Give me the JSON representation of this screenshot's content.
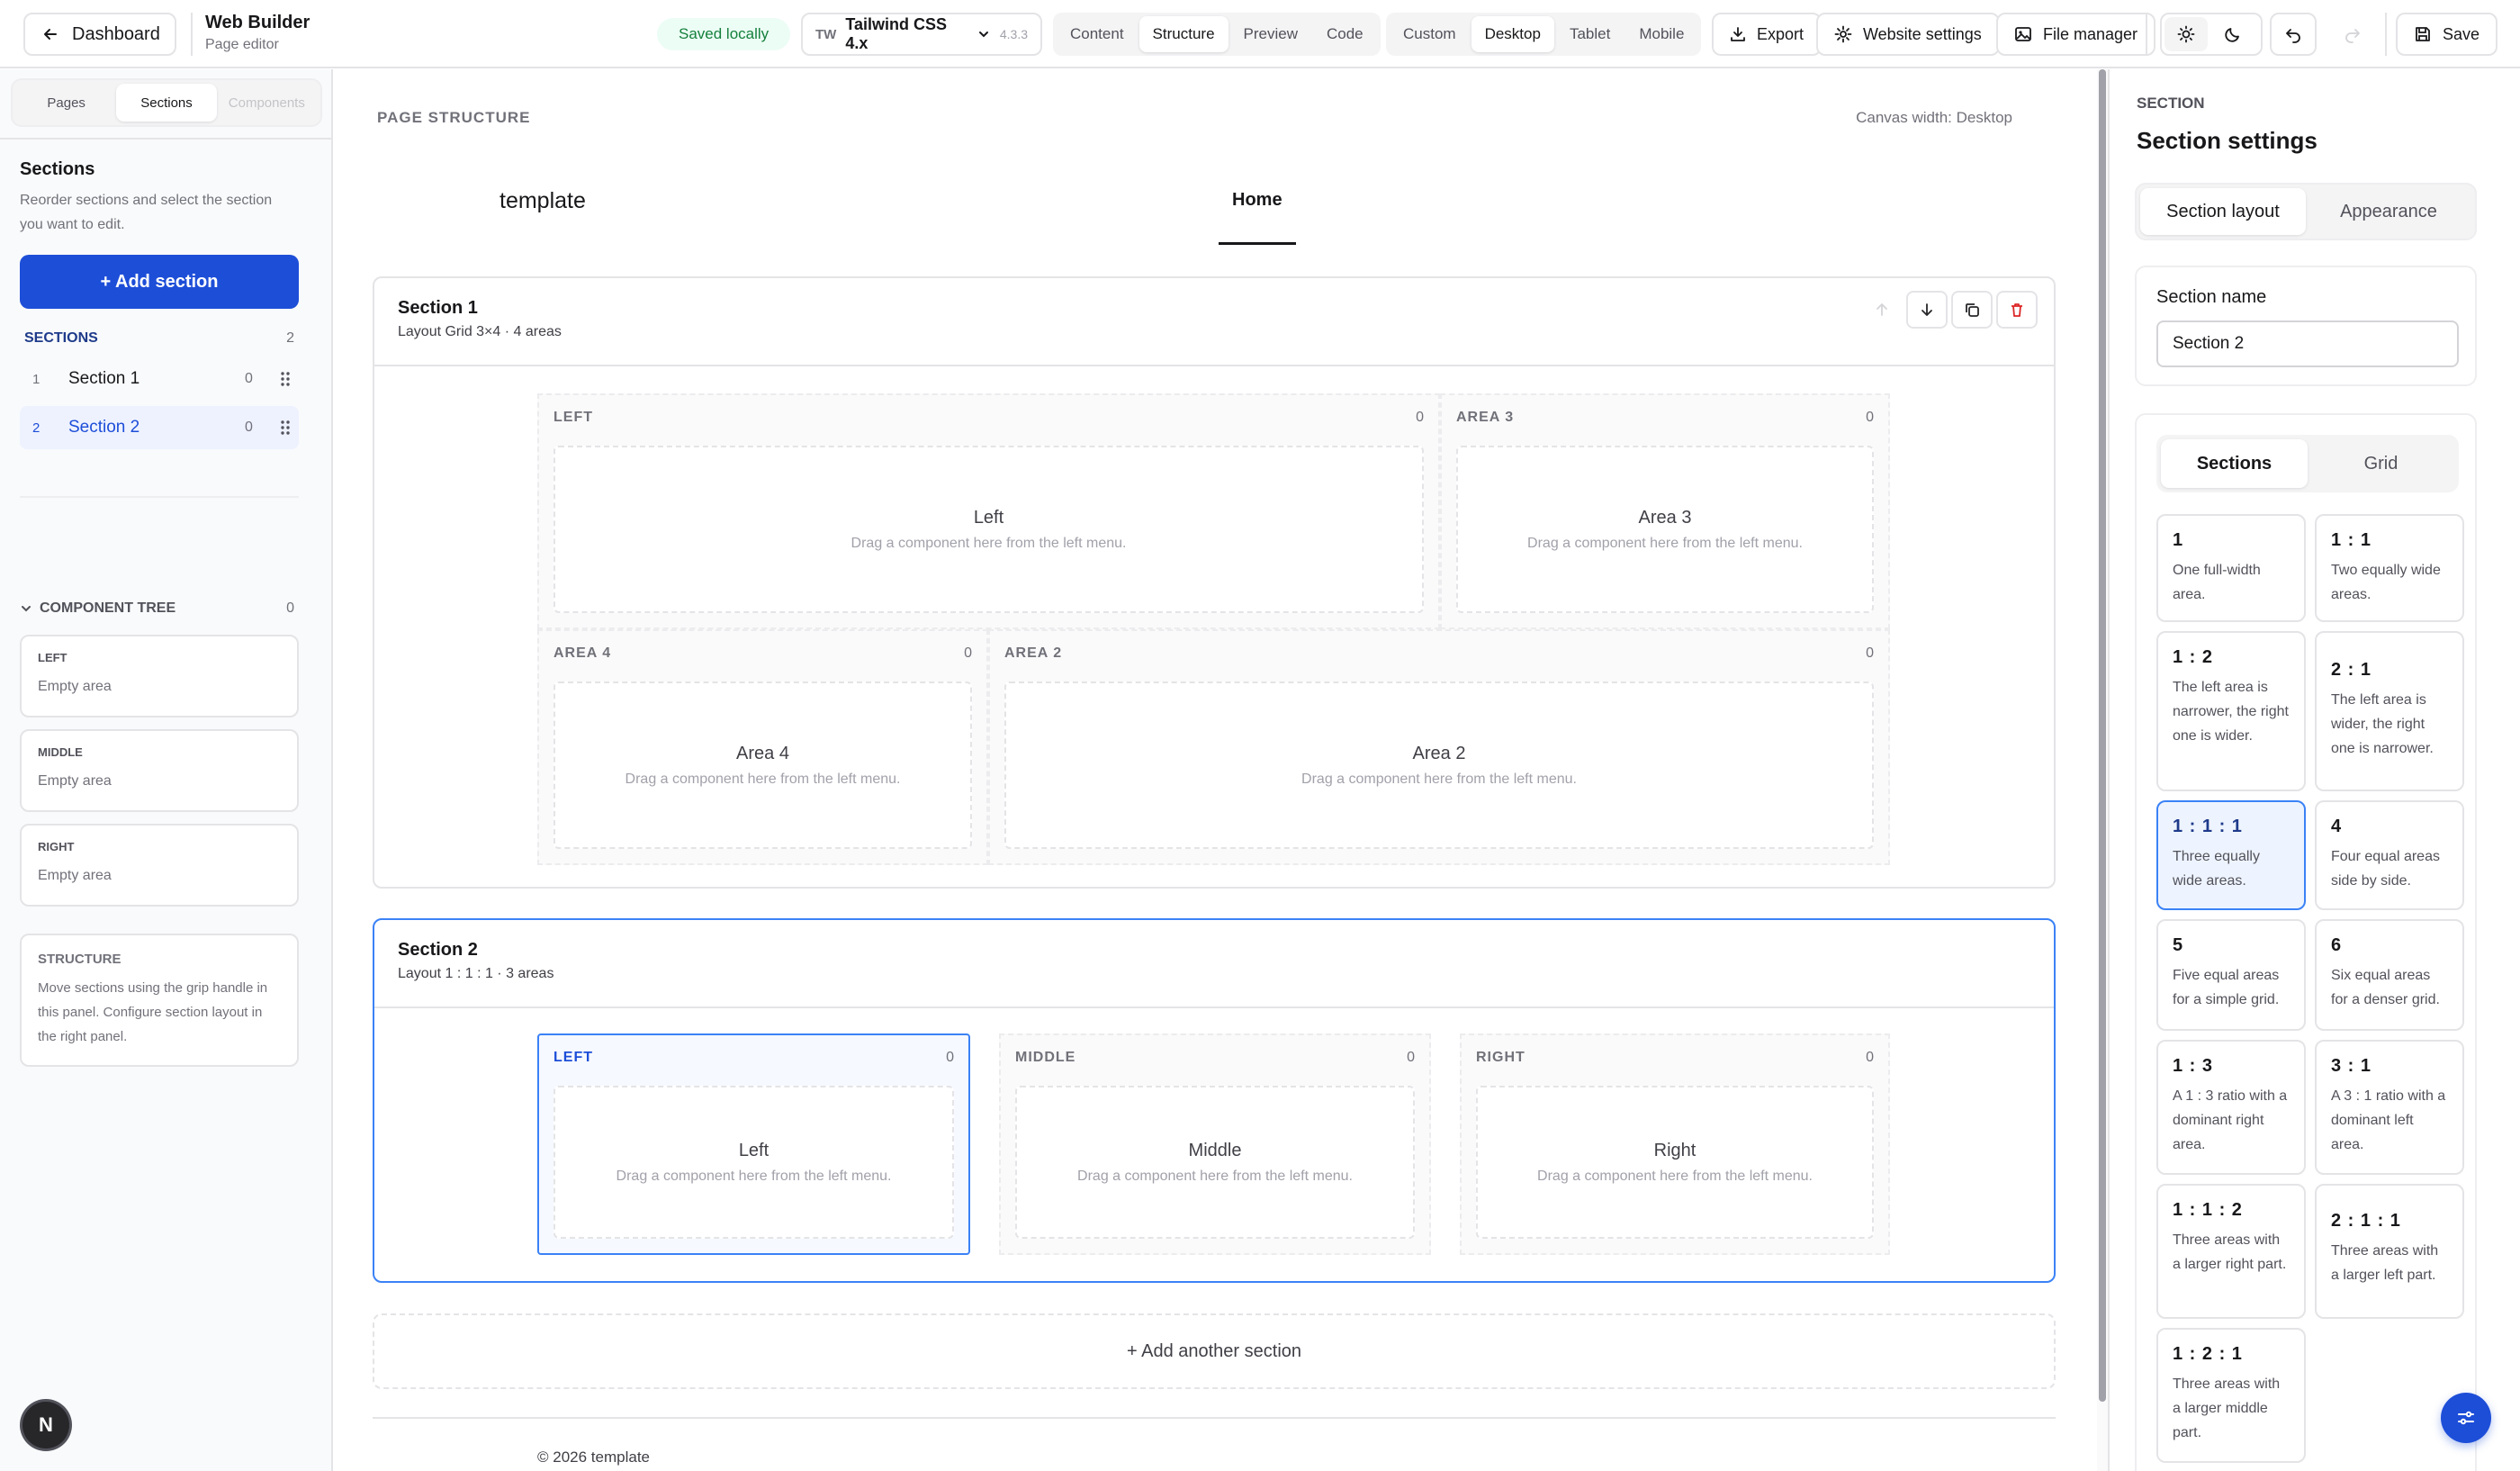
{
  "topbar": {
    "back_label": "Dashboard",
    "app_title": "Web Builder",
    "app_subtitle": "Page editor",
    "saved_status": "Saved locally",
    "framework": {
      "prefix": "TW",
      "name": "Tailwind CSS 4.x",
      "version": "4.3.3"
    },
    "view_modes": [
      "Content",
      "Structure",
      "Preview",
      "Code"
    ],
    "active_view_mode": "Structure",
    "devices": [
      "Custom",
      "Desktop",
      "Tablet",
      "Mobile"
    ],
    "active_device": "Desktop",
    "export_label": "Export",
    "website_settings_label": "Website settings",
    "file_manager_label": "File manager",
    "save_label": "Save"
  },
  "left": {
    "tabs": [
      "Pages",
      "Sections",
      "Components"
    ],
    "active_tab": "Sections",
    "title": "Sections",
    "description": "Reorder sections and select the section you want to edit.",
    "add_button": "+ Add section",
    "sections_header": "SECTIONS",
    "sections_count": "2",
    "sections": [
      {
        "num": "1",
        "label": "Section 1",
        "count": "0"
      },
      {
        "num": "2",
        "label": "Section 2",
        "count": "0"
      }
    ],
    "tree_header": "COMPONENT TREE",
    "tree_count": "0",
    "tree": [
      {
        "label": "LEFT",
        "value": "Empty area"
      },
      {
        "label": "MIDDLE",
        "value": "Empty area"
      },
      {
        "label": "RIGHT",
        "value": "Empty area"
      }
    ],
    "structure_title": "STRUCTURE",
    "structure_text": "Move sections using the grip handle in this panel. Configure section layout in the right panel.",
    "user_initial": "N"
  },
  "canvas": {
    "heading": "PAGE STRUCTURE",
    "width_label": "Canvas width: Desktop",
    "site_logo": "template",
    "nav_item": "Home",
    "drag_hint": "Drag a component here from the left menu.",
    "section1": {
      "title": "Section 1",
      "subtitle": "Layout Grid 3×4 · 4 areas",
      "areas": [
        {
          "label": "LEFT",
          "count": "0",
          "name": "Left"
        },
        {
          "label": "AREA 3",
          "count": "0",
          "name": "Area 3"
        },
        {
          "label": "AREA 4",
          "count": "0",
          "name": "Area 4"
        },
        {
          "label": "AREA 2",
          "count": "0",
          "name": "Area 2"
        }
      ]
    },
    "section2": {
      "title": "Section 2",
      "subtitle": "Layout 1 : 1 : 1 · 3 areas",
      "areas": [
        {
          "label": "LEFT",
          "count": "0",
          "name": "Left"
        },
        {
          "label": "MIDDLE",
          "count": "0",
          "name": "Middle"
        },
        {
          "label": "RIGHT",
          "count": "0",
          "name": "Right"
        }
      ]
    },
    "add_another": "+ Add another section",
    "footer": "© 2026 template"
  },
  "right": {
    "caption": "SECTION",
    "title": "Section settings",
    "tabs": [
      "Section layout",
      "Appearance"
    ],
    "active_tab": "Section layout",
    "name_label": "Section name",
    "name_value": "Section 2",
    "layout_tabs": [
      "Sections",
      "Grid"
    ],
    "active_layout_tab": "Sections",
    "layouts": [
      {
        "ratio": "1",
        "desc": "One full-width area."
      },
      {
        "ratio": "1 : 1",
        "desc": "Two equally wide areas."
      },
      {
        "ratio": "1 : 2",
        "desc": "The left area is narrower, the right one is wider."
      },
      {
        "ratio": "2 : 1",
        "desc": "The left area is wider, the right one is narrower."
      },
      {
        "ratio": "1 : 1 : 1",
        "desc": "Three equally wide areas."
      },
      {
        "ratio": "4",
        "desc": "Four equal areas side by side."
      },
      {
        "ratio": "5",
        "desc": "Five equal areas for a simple grid."
      },
      {
        "ratio": "6",
        "desc": "Six equal areas for a denser grid."
      },
      {
        "ratio": "1 : 3",
        "desc": "A 1 : 3 ratio with a dominant right area."
      },
      {
        "ratio": "3 : 1",
        "desc": "A 3 : 1 ratio with a dominant left area."
      },
      {
        "ratio": "1 : 1 : 2",
        "desc": "Three areas with a larger right part."
      },
      {
        "ratio": "2 : 1 : 1",
        "desc": "Three areas with a larger left part."
      },
      {
        "ratio": "1 : 2 : 1",
        "desc": "Three areas with a larger middle part."
      }
    ],
    "selected_layout": "1 : 1 : 1"
  },
  "colors": {
    "accent": "#1d4ed8",
    "selection": "#3b82f6",
    "saved_bg": "#ecfdf5",
    "saved_text": "#15803d",
    "danger": "#dc2626"
  }
}
